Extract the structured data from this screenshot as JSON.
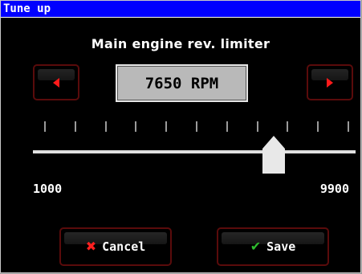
{
  "window": {
    "title": "Tune up"
  },
  "heading": "Main engine rev. limiter",
  "value": {
    "display": "7650 RPM",
    "rpm": 7650
  },
  "slider": {
    "min": 1000,
    "max": 9900,
    "value": 7650,
    "min_label": "1000",
    "max_label": "9900",
    "tick_count": 11
  },
  "buttons": {
    "cancel_label": "Cancel",
    "save_label": "Save"
  },
  "icons": {
    "decrease": "left-arrow-icon",
    "increase": "right-arrow-icon",
    "cancel": "x-icon",
    "save": "check-icon"
  },
  "colors": {
    "title_bar": "#0000ff",
    "background": "#000000",
    "arrow": "#ff1a1a",
    "cancel_icon": "#ff2020",
    "save_icon": "#2ebd2e",
    "button_border": "#5a0b0b"
  }
}
